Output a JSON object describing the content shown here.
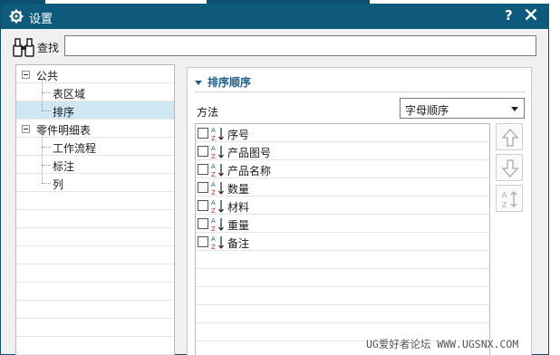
{
  "window": {
    "title": "设置",
    "help_label": "?",
    "close_icon": "close-icon",
    "gear_icon": "gear-icon",
    "title_color": "#0d5a7d"
  },
  "find": {
    "label": "查找",
    "value": "",
    "placeholder": "",
    "icon": "binoculars-icon"
  },
  "tree": {
    "items": [
      {
        "label": "公共",
        "level": 0,
        "expanded": true
      },
      {
        "label": "表区域",
        "level": 1
      },
      {
        "label": "排序",
        "level": 1,
        "selected": true
      },
      {
        "label": "零件明细表",
        "level": 0,
        "expanded": true
      },
      {
        "label": "工作流程",
        "level": 1
      },
      {
        "label": "标注",
        "level": 1
      },
      {
        "label": "列",
        "level": 1
      }
    ],
    "selected_color": "#cfe6f3"
  },
  "panel": {
    "section_title": "排序顺序",
    "method_label": "方法",
    "method_value": "字母顺序",
    "columns": [
      {
        "label": "序号",
        "checked": false
      },
      {
        "label": "产品图号",
        "checked": false
      },
      {
        "label": "产品名称",
        "checked": false
      },
      {
        "label": "数量",
        "checked": false
      },
      {
        "label": "材料",
        "checked": false
      },
      {
        "label": "重量",
        "checked": false
      },
      {
        "label": "备注",
        "checked": false
      }
    ],
    "side_buttons": [
      "move-up-icon",
      "move-down-icon",
      "sort-az-icon"
    ],
    "accent_color": "#1f5f86"
  },
  "watermark": "UG爱好者论坛 WWW.UGSNX.COM"
}
